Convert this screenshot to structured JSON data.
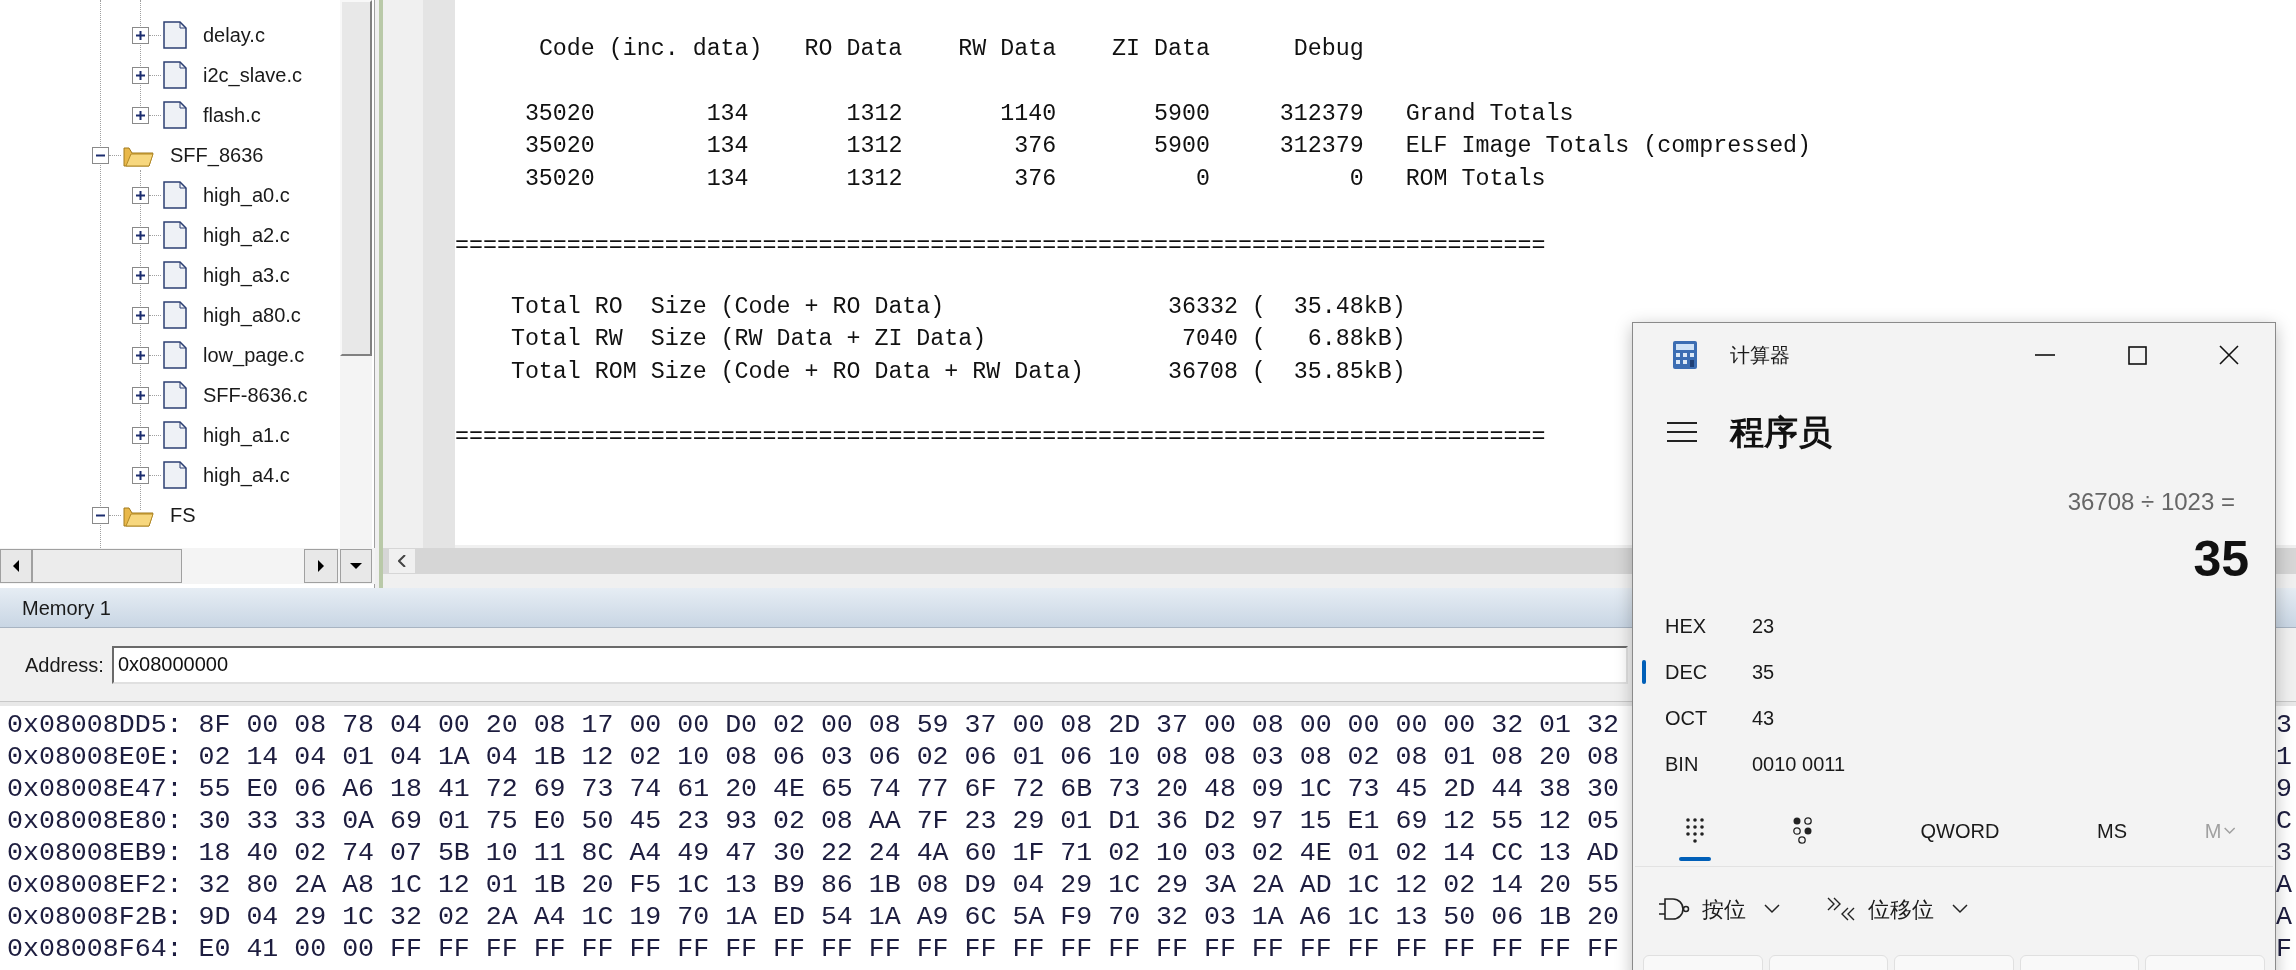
{
  "project_tree": {
    "items": [
      {
        "kind": "hidden_parent",
        "children": [
          {
            "kind": "file",
            "label": "delay.c",
            "expanded": false
          },
          {
            "kind": "file",
            "label": "i2c_slave.c",
            "expanded": false
          },
          {
            "kind": "file",
            "label": "flash.c",
            "expanded": false
          }
        ]
      },
      {
        "kind": "folder",
        "label": "SFF_8636",
        "expanded": true,
        "children": [
          {
            "kind": "file",
            "label": "high_a0.c",
            "expanded": false
          },
          {
            "kind": "file",
            "label": "high_a2.c",
            "expanded": false
          },
          {
            "kind": "file",
            "label": "high_a3.c",
            "expanded": false
          },
          {
            "kind": "file",
            "label": "high_a80.c",
            "expanded": false
          },
          {
            "kind": "file",
            "label": "low_page.c",
            "expanded": false
          },
          {
            "kind": "file",
            "label": "SFF-8636.c",
            "expanded": false
          },
          {
            "kind": "file",
            "label": "high_a1.c",
            "expanded": false
          },
          {
            "kind": "file",
            "label": "high_a4.c",
            "expanded": false
          }
        ]
      },
      {
        "kind": "folder",
        "label": "FS",
        "expanded": true
      }
    ]
  },
  "build_output": {
    "header": [
      "Code (inc. data)",
      "RO Data",
      "RW Data",
      "ZI Data",
      "Debug"
    ],
    "totals": [
      {
        "values": [
          "35020",
          "134",
          "1312",
          "1140",
          "5900",
          "312379"
        ],
        "label": "Grand Totals"
      },
      {
        "values": [
          "35020",
          "134",
          "1312",
          "376",
          "5900",
          "312379"
        ],
        "label": "ELF Image Totals (compressed)"
      },
      {
        "values": [
          "35020",
          "134",
          "1312",
          "376",
          "0",
          "0"
        ],
        "label": "ROM Totals"
      }
    ],
    "separator_top": "==============================================================================",
    "sizes": [
      {
        "label": "Total RO  Size (Code + RO Data)",
        "bytes": "36332",
        "kb": "(  35.48kB)"
      },
      {
        "label": "Total RW  Size (RW Data + ZI Data)",
        "bytes": "7040",
        "kb": "(   6.88kB)"
      },
      {
        "label": "Total ROM Size (Code + RO Data + RW Data)",
        "bytes": "36708",
        "kb": "(  35.85kB)"
      }
    ],
    "separator_bottom": "=============================================================================="
  },
  "memory": {
    "title": "Memory 1",
    "address_label": "Address:",
    "address": "0x08000000",
    "rows": [
      {
        "address": "0x08008DD5:",
        "bytes": "8F 00 08 78 04 00 20 08 17 00 00 D0 02 00 08 59 37 00 08 2D 37 00 08 00 00 00 00 32 01 32",
        "tail": "3"
      },
      {
        "address": "0x08008E0E:",
        "bytes": "02 14 04 01 04 1A 04 1B 12 02 10 08 06 03 06 02 06 01 06 10 08 08 03 08 02 08 01 08 20 08",
        "tail": "1"
      },
      {
        "address": "0x08008E47:",
        "bytes": "55 E0 06 A6 18 41 72 69 73 74 61 20 4E 65 74 77 6F 72 6B 73 20 48 09 1C 73 45 2D 44 38 30",
        "tail": "9"
      },
      {
        "address": "0x08008E80:",
        "bytes": "30 33 33 0A 69 01 75 E0 50 45 23 93 02 08 AA 7F 23 29 01 D1 36 D2 97 15 E1 69 12 55 12 05",
        "tail": "C"
      },
      {
        "address": "0x08008EB9:",
        "bytes": "18 40 02 74 07 5B 10 11 8C A4 49 47 30 22 24 4A 60 1F 71 02 10 03 02 4E 01 02 14 CC 13 AD",
        "tail": "3"
      },
      {
        "address": "0x08008EF2:",
        "bytes": "32 80 2A A8 1C 12 01 1B 20 F5 1C 13 B9 86 1B 08 D9 04 29 1C 29 3A 2A AD 1C 12 02 14 20 55",
        "tail": "A"
      },
      {
        "address": "0x08008F2B:",
        "bytes": "9D 04 29 1C 32 02 2A A4 1C 19 70 1A ED 54 1A A9 6C 5A F9 70 32 03 1A A6 1C 13 50 06 1B 20",
        "tail": "A"
      },
      {
        "address": "0x08008F64:",
        "bytes": "E0 41 00 00 FF FF FF FF FF FF FF FF FF FF FF FF FF FF FF FF FF FF FF FF FF FF FF FF FF FF",
        "tail": "F"
      }
    ]
  },
  "calculator": {
    "title": "计算器",
    "mode": "程序员",
    "expression": "36708 ÷ 1023 =",
    "result": "35",
    "radix": [
      {
        "name": "HEX",
        "value": "23",
        "selected": false
      },
      {
        "name": "DEC",
        "value": "35",
        "selected": true
      },
      {
        "name": "OCT",
        "value": "43",
        "selected": false
      },
      {
        "name": "BIN",
        "value": "0010 0011",
        "selected": false
      }
    ],
    "toolbar": [
      {
        "kind": "keypad",
        "selected": true
      },
      {
        "kind": "bit_toggle",
        "selected": false
      },
      {
        "kind": "text",
        "label": "QWORD"
      },
      {
        "kind": "text",
        "label": "MS"
      },
      {
        "kind": "memory_menu",
        "label": "M",
        "disabled": true
      }
    ],
    "bitwise": [
      {
        "kind": "gate",
        "label": "按位"
      },
      {
        "kind": "shift",
        "label": "位移位"
      }
    ]
  }
}
